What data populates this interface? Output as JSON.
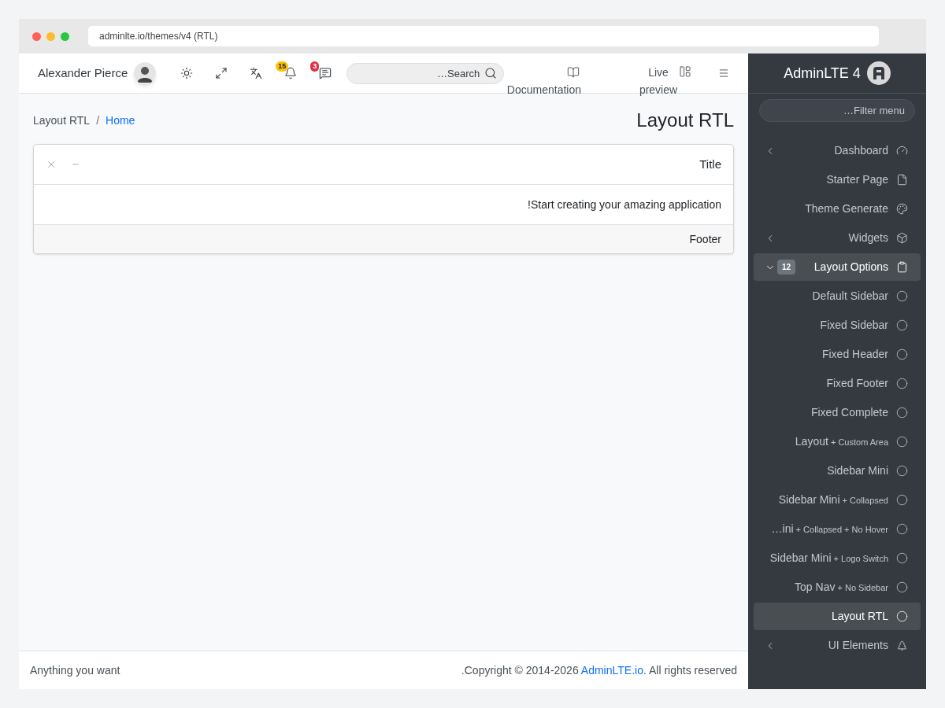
{
  "browser": {
    "url": "adminlte.io/themes/v4 (RTL)"
  },
  "navbar": {
    "user": {
      "name": "Alexander Pierce"
    },
    "tools": [
      {
        "kind": "theme"
      },
      {
        "kind": "fullscreen"
      },
      {
        "kind": "language"
      },
      {
        "kind": "notifications",
        "badge": "15",
        "color": "#ffc107"
      },
      {
        "kind": "messages",
        "badge": "3",
        "color": "#dc3545"
      }
    ],
    "search": {
      "placeholder": "…Search"
    },
    "links": [
      {
        "kind": "docs",
        "label": "Documentation"
      },
      {
        "kind": "preview",
        "label": "Live preview"
      }
    ]
  },
  "content_header": {
    "title": "Layout RTL",
    "separator": "/",
    "breadcrumb": [
      {
        "label": "Layout RTL",
        "selected": true
      },
      {
        "label": "Home",
        "selected": false
      }
    ]
  },
  "card": {
    "title": "Title",
    "body": "!Start creating your amazing application",
    "footer": "Footer"
  },
  "footer": {
    "left": "Anything you want",
    "copyright": ".Copyright © 2014-2026 ",
    "link": "AdminLTE.io",
    "rights": ". All rights reserved"
  },
  "sidebar": {
    "brand": "AdminLTE 4",
    "filter": {
      "placeholder": "…Filter menu"
    },
    "items": [
      {
        "label": "Dashboard",
        "expanded": false
      },
      {
        "label": "Starter Page"
      },
      {
        "label": "Theme Generate"
      },
      {
        "label": "Widgets",
        "expanded": false
      },
      {
        "label": "Layout Options",
        "expanded": true,
        "badge": "12",
        "children": [
          {
            "label": "Default Sidebar",
            "selected": false
          },
          {
            "label": "Fixed Sidebar",
            "selected": false
          },
          {
            "label": "Fixed Header",
            "selected": false
          },
          {
            "label": "Fixed Footer",
            "selected": false
          },
          {
            "label": "Fixed Complete",
            "selected": false
          },
          {
            "label": "Layout",
            "suffix": "+ Custom Area",
            "selected": false
          },
          {
            "label": "Sidebar Mini",
            "selected": false
          },
          {
            "label": "Sidebar Mini",
            "suffix": "+ Collapsed",
            "selected": false
          },
          {
            "label": "…ini",
            "suffix": "+ Collapsed + No Hover",
            "selected": false
          },
          {
            "label": "Sidebar Mini",
            "suffix": "+ Logo Switch",
            "selected": false
          },
          {
            "label": "Top Nav",
            "suffix": "+ No Sidebar",
            "selected": false
          },
          {
            "label": "Layout RTL",
            "selected": true
          }
        ]
      },
      {
        "label": "UI Elements",
        "expanded": false
      }
    ]
  }
}
